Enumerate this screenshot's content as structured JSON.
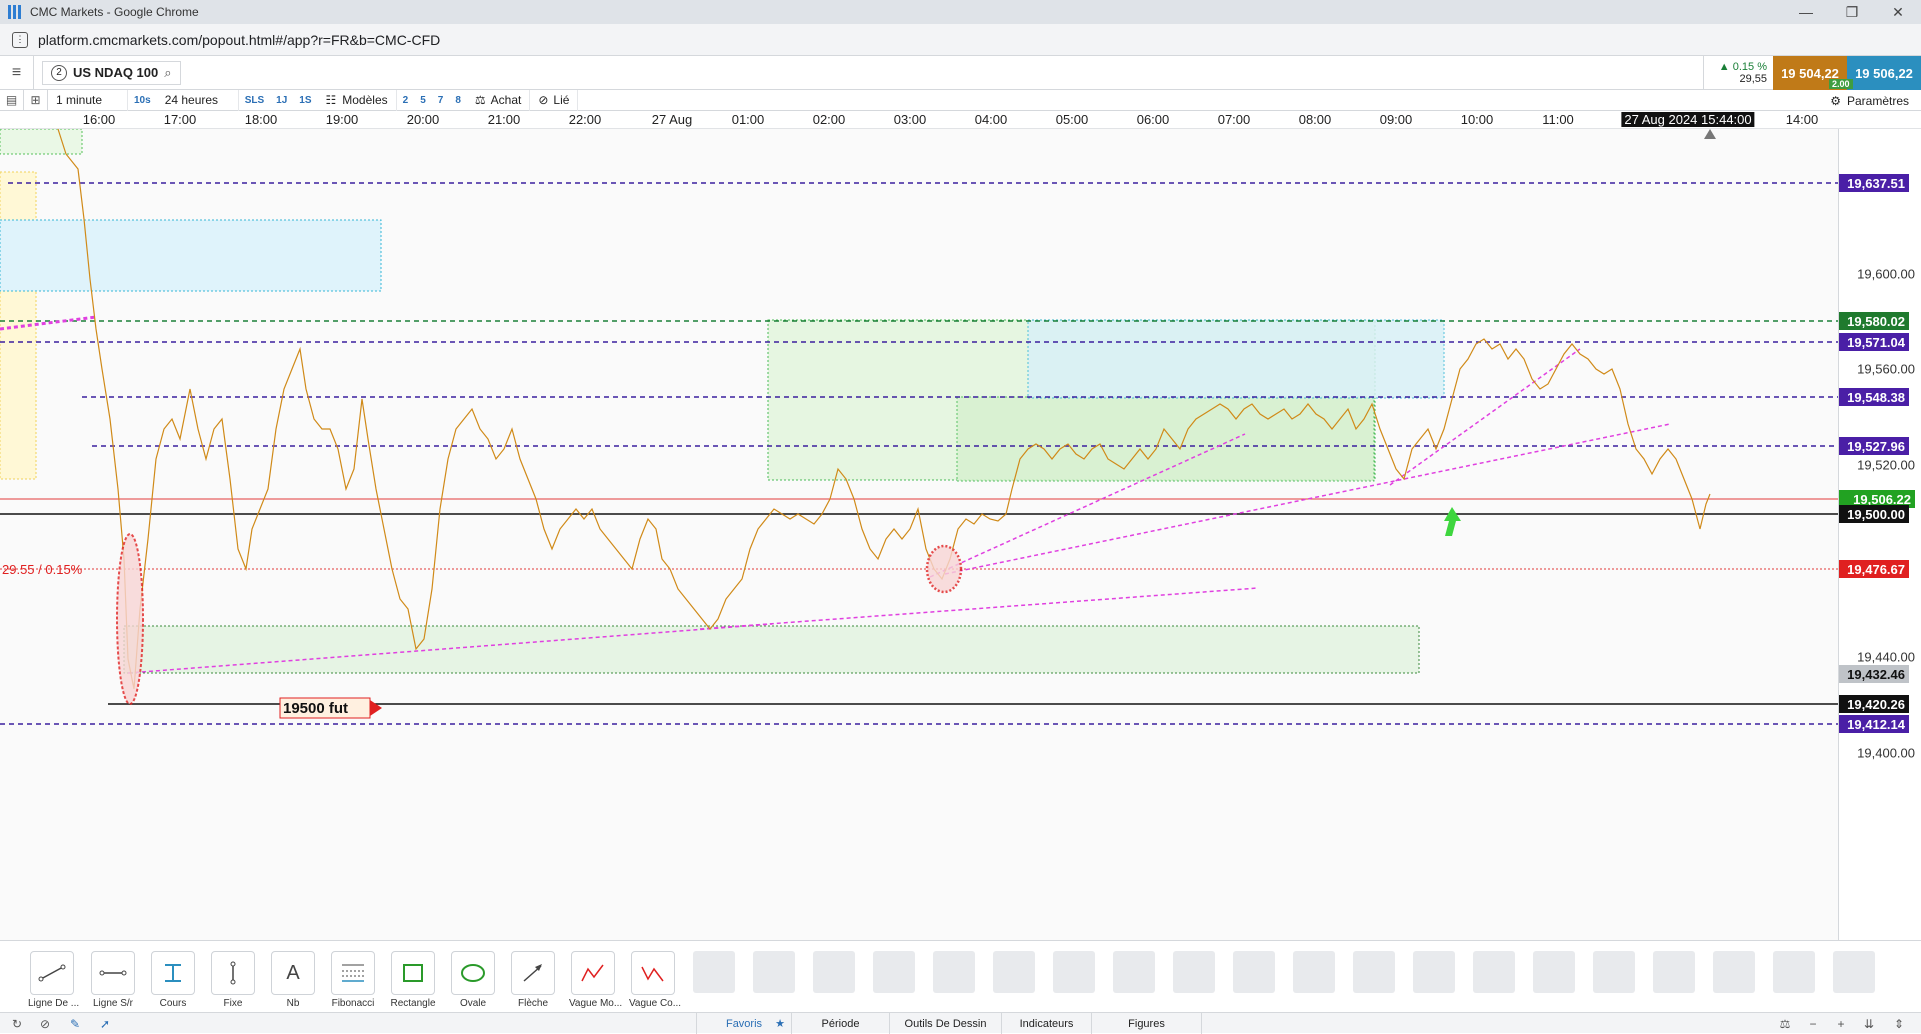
{
  "window": {
    "title": "CMC Markets - Google Chrome",
    "url": "platform.cmcmarkets.com/popout.html#/app?r=FR&b=CMC-CFD"
  },
  "instrument": {
    "panel_num": "2",
    "name": "US NDAQ 100"
  },
  "quote": {
    "change_pct": "▲ 0.15 %",
    "change_pts": "29,55",
    "sell": "19 504,22",
    "buy": "19 506,22",
    "spread": "2.00"
  },
  "toolbar": {
    "interval": "1 minute",
    "i10s": "10s",
    "range": "24 heures",
    "sls": "SLS",
    "d1": "1J",
    "s1": "1S",
    "templates": "Modèles",
    "n2": "2",
    "n5": "5",
    "n7": "7",
    "n8": "8",
    "buy": "Achat",
    "link": "Lié",
    "settings": "Paramètres"
  },
  "time_axis": [
    "16:00",
    "17:00",
    "18:00",
    "19:00",
    "20:00",
    "21:00",
    "22:00",
    "27 Aug",
    "01:00",
    "02:00",
    "03:00",
    "04:00",
    "05:00",
    "06:00",
    "07:00",
    "08:00",
    "09:00",
    "10:00",
    "11:00",
    "14:00"
  ],
  "crosshair_time": "27 Aug 2024 15:44:00",
  "price_ticks": [
    "19,600.00",
    "19,560.00",
    "19,520.00",
    "19,440.00",
    "19,400.00"
  ],
  "price_tags": {
    "t1": "19,637.51",
    "t2": "19,580.02",
    "t3": "19,571.04",
    "t4": "19,548.38",
    "t5": "19,527.96",
    "t6": "19,506.22",
    "t7": "19,500.00",
    "t8": "19,476.67",
    "t9": "19,432.46",
    "t10": "19,420.26",
    "t11": "19,412.14"
  },
  "annotations": {
    "change_line": "29.55 / 0.15%",
    "fut_label": "19500 fut"
  },
  "tools": [
    "Ligne De ...",
    "Ligne S/r",
    "Cours",
    "Fixe",
    "Nb",
    "Fibonacci",
    "Rectangle",
    "Ovale",
    "Flèche",
    "Vague Mo...",
    "Vague Co..."
  ],
  "bottom_tabs": {
    "favorites": "Favoris",
    "period": "Période",
    "drawing": "Outils De Dessin",
    "indicators": "Indicateurs",
    "figures": "Figures"
  },
  "colors": {
    "up": "#1a7f37",
    "sell": "#c07a18",
    "buy": "#2b8fbf",
    "level_purple": "#3b1f9e",
    "trend_pink": "#e040e0"
  }
}
